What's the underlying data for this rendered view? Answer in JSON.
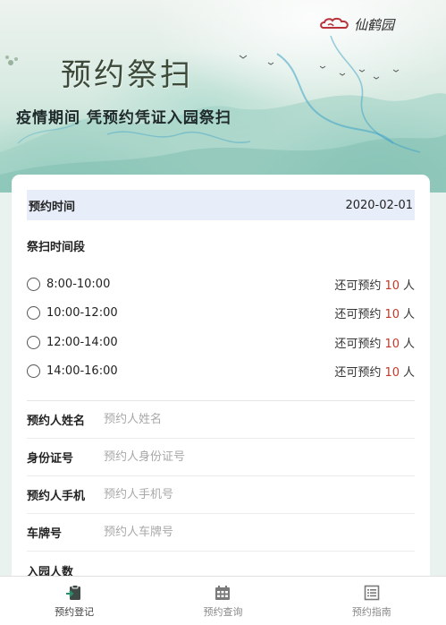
{
  "hero": {
    "logo_text": "仙鹤园",
    "title": "预约祭扫",
    "subtitle": "疫情期间 凭预约凭证入园祭扫"
  },
  "form": {
    "date_label": "预约时间",
    "date_value": "2020-02-01",
    "slot_section_label": "祭扫时间段",
    "slots": [
      {
        "time": "8:00-10:00",
        "avail_prefix": "还可预约",
        "count": "10",
        "unit": "人"
      },
      {
        "time": "10:00-12:00",
        "avail_prefix": "还可预约",
        "count": "10",
        "unit": "人"
      },
      {
        "time": "12:00-14:00",
        "avail_prefix": "还可预约",
        "count": "10",
        "unit": "人"
      },
      {
        "time": "14:00-16:00",
        "avail_prefix": "还可预约",
        "count": "10",
        "unit": "人"
      }
    ],
    "fields": [
      {
        "label": "预约人姓名",
        "placeholder": "预约人姓名",
        "value": ""
      },
      {
        "label": "身份证号",
        "placeholder": "预约人身份证号",
        "value": ""
      },
      {
        "label": "预约人手机",
        "placeholder": "预约人手机号",
        "value": ""
      },
      {
        "label": "车牌号",
        "placeholder": "预约人车牌号",
        "value": ""
      },
      {
        "label": "入园人数",
        "placeholder": "",
        "value": ""
      }
    ]
  },
  "nav": {
    "items": [
      {
        "label": "预约登记",
        "icon": "register-icon",
        "active": true
      },
      {
        "label": "预约查询",
        "icon": "calendar-icon",
        "active": false
      },
      {
        "label": "预约指南",
        "icon": "guide-icon",
        "active": false
      }
    ]
  },
  "colors": {
    "accent_count": "#c0392b",
    "date_row_bg": "#e7eefa"
  }
}
